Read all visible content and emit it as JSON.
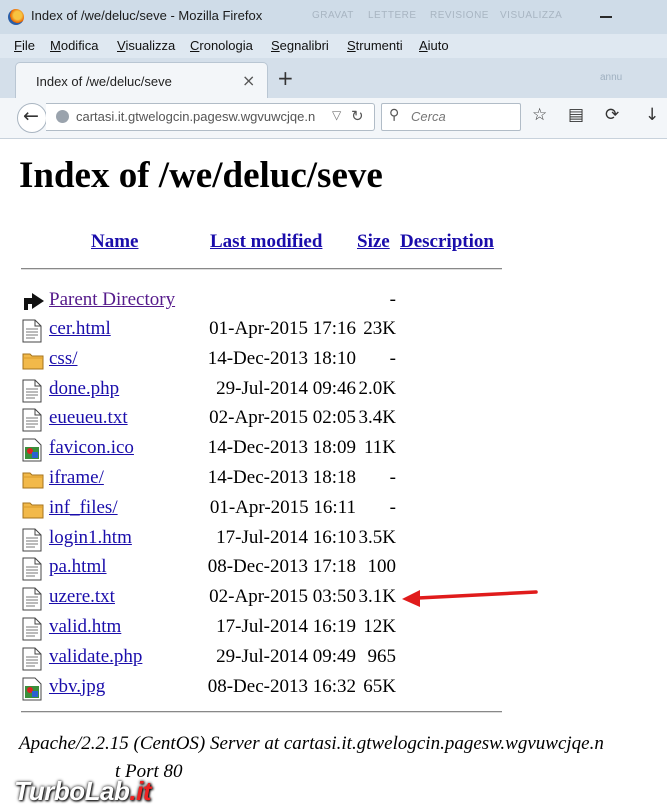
{
  "window": {
    "title": "Index of /we/deluc/seve - Mozilla Firefox",
    "ghost_menu": [
      "GRAVAT",
      "LETTERE",
      "REVISIONE",
      "VISUALIZZA"
    ],
    "ghost_right": "annu"
  },
  "menubar": [
    {
      "label": "File",
      "mnemonic": "F",
      "rest": "ile"
    },
    {
      "label": "Modifica",
      "mnemonic": "M",
      "rest": "odifica"
    },
    {
      "label": "Visualizza",
      "mnemonic": "V",
      "rest": "isualizza"
    },
    {
      "label": "Cronologia",
      "mnemonic": "C",
      "rest": "ronologia"
    },
    {
      "label": "Segnalibri",
      "mnemonic": "S",
      "rest": "egnalibri"
    },
    {
      "label": "Strumenti",
      "mnemonic": "S",
      "rest": "trumenti"
    },
    {
      "label": "Aiuto",
      "mnemonic": "A",
      "rest": "iuto"
    }
  ],
  "tab": {
    "label": "Index of /we/deluc/seve",
    "close": "×",
    "new_tab": "+"
  },
  "toolbar": {
    "url": "cartasi.it.gtwelogcin.pagesw.wgvuwcjqe.n",
    "search_placeholder": "Cerca",
    "icons": [
      "back-icon",
      "globe-icon",
      "dropdown-icon",
      "reload-icon",
      "search-icon",
      "bookmark-star-icon",
      "reading-list-icon",
      "sync-icon",
      "download-icon"
    ]
  },
  "page": {
    "heading": "Index of /we/deluc/seve",
    "columns": {
      "name": "Name",
      "last_modified": "Last modified",
      "size": "Size",
      "description": "Description"
    },
    "parent": {
      "name": "Parent Directory",
      "size": "-"
    },
    "entries": [
      {
        "name": "cer.html",
        "date": "01-Apr-2015 17:16",
        "size": "23K",
        "icon": "text"
      },
      {
        "name": "css/",
        "date": "14-Dec-2013 18:10",
        "size": "-",
        "icon": "folder"
      },
      {
        "name": "done.php",
        "date": "29-Jul-2014 09:46",
        "size": "2.0K",
        "icon": "text"
      },
      {
        "name": "eueueu.txt",
        "date": "02-Apr-2015 02:05",
        "size": "3.4K",
        "icon": "text"
      },
      {
        "name": "favicon.ico",
        "date": "14-Dec-2013 18:09",
        "size": "11K",
        "icon": "image"
      },
      {
        "name": "iframe/",
        "date": "14-Dec-2013 18:18",
        "size": "-",
        "icon": "folder"
      },
      {
        "name": "inf_files/",
        "date": "01-Apr-2015 16:11",
        "size": "-",
        "icon": "folder"
      },
      {
        "name": "login1.htm",
        "date": "17-Jul-2014 16:10",
        "size": "3.5K",
        "icon": "text"
      },
      {
        "name": "pa.html",
        "date": "08-Dec-2013 17:18",
        "size": "100",
        "icon": "text"
      },
      {
        "name": "uzere.txt",
        "date": "02-Apr-2015 03:50",
        "size": "3.1K",
        "icon": "text"
      },
      {
        "name": "valid.htm",
        "date": "17-Jul-2014 16:19",
        "size": "12K",
        "icon": "text"
      },
      {
        "name": "validate.php",
        "date": "29-Jul-2014 09:49",
        "size": "965",
        "icon": "text"
      },
      {
        "name": "vbv.jpg",
        "date": "08-Dec-2013 16:32",
        "size": "65K",
        "icon": "image"
      }
    ],
    "address": "Apache/2.2.15 (CentOS) Server at cartasi.it.gtwelogcin.pagesw.wgvuwcjqe.n",
    "address_line2": "t Port 80",
    "annotation_color": "#e01b1b"
  },
  "watermark": {
    "brand": "TurboLab",
    "tld": ".it"
  }
}
